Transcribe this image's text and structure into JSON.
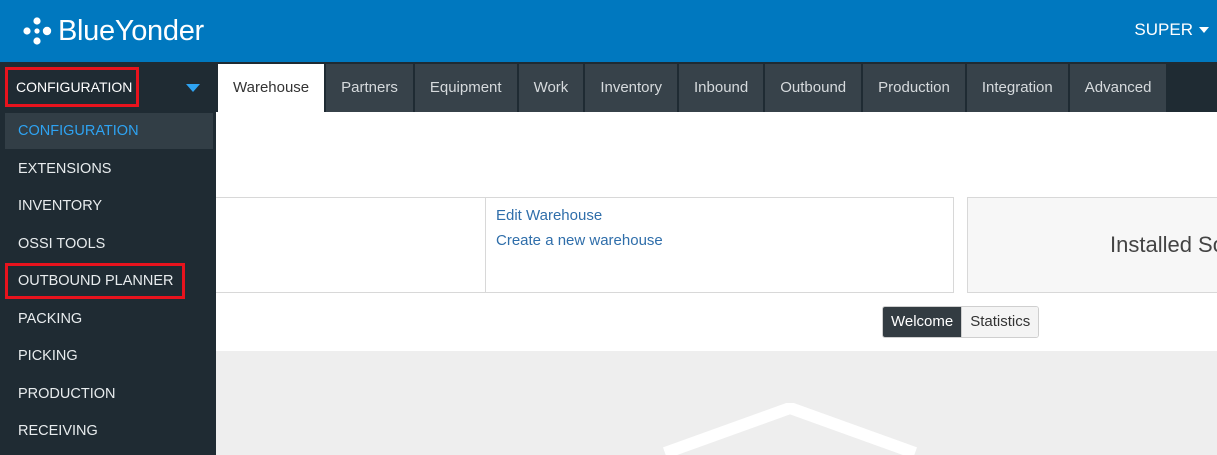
{
  "header": {
    "brand": "BlueYonder",
    "user": "SUPER"
  },
  "module_selector": {
    "selected": "CONFIGURATION"
  },
  "tabs": [
    {
      "label": "Warehouse",
      "active": true
    },
    {
      "label": "Partners"
    },
    {
      "label": "Equipment"
    },
    {
      "label": "Work"
    },
    {
      "label": "Inventory"
    },
    {
      "label": "Inbound"
    },
    {
      "label": "Outbound"
    },
    {
      "label": "Production"
    },
    {
      "label": "Integration"
    },
    {
      "label": "Advanced"
    }
  ],
  "dropdown": {
    "items": [
      {
        "label": "CONFIGURATION",
        "active": true
      },
      {
        "label": "EXTENSIONS"
      },
      {
        "label": "INVENTORY"
      },
      {
        "label": "OSSI TOOLS"
      },
      {
        "label": "OUTBOUND PLANNER",
        "highlighted": true
      },
      {
        "label": "PACKING"
      },
      {
        "label": "PICKING"
      },
      {
        "label": "PRODUCTION"
      },
      {
        "label": "RECEIVING"
      }
    ]
  },
  "links": {
    "edit": "Edit Warehouse",
    "create": "Create a new warehouse"
  },
  "installed_panel": {
    "title": "Installed So"
  },
  "view_toggle": {
    "welcome": "Welcome",
    "statistics": "Statistics"
  },
  "colors": {
    "header_bg": "#0078bf",
    "nav_bg": "#1f2b33",
    "tab_bg": "#37424a",
    "highlight_border": "#e8131d",
    "active_item": "#2ea3f2"
  },
  "icons": {
    "logo": "blueyonder-logo-icon",
    "user_caret": "caret-down-icon",
    "module_caret": "chevron-down-icon"
  }
}
